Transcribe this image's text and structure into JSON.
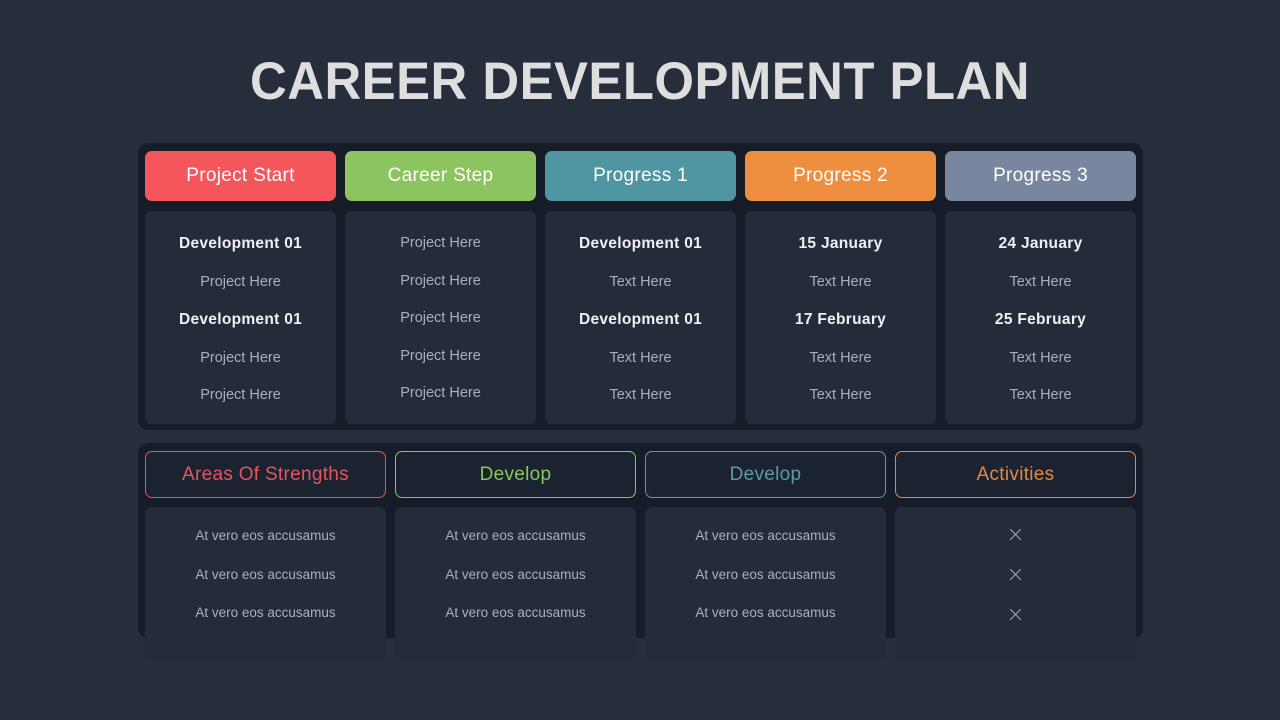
{
  "title": "CAREER DEVELOPMENT PLAN",
  "theme": {
    "page_bg": "#262d3b",
    "panel_bg": "#171d28",
    "card_bg": "#242b39",
    "title_color": "#dedede",
    "body_text": "#a9b0bd",
    "bold_text": "#eef1f5"
  },
  "top_section": {
    "columns": [
      {
        "pill_label": "Project Start",
        "pill_color": "#f4565c",
        "rows": [
          {
            "text": "Development 01",
            "bold": true
          },
          {
            "text": "Project Here",
            "bold": false
          },
          {
            "text": "Development 01",
            "bold": true
          },
          {
            "text": "Project Here",
            "bold": false
          },
          {
            "text": "Project Here",
            "bold": false
          }
        ]
      },
      {
        "pill_label": "Career Step",
        "pill_color": "#8cc45f",
        "rows": [
          {
            "text": "Project Here",
            "bold": false
          },
          {
            "text": "Project Here",
            "bold": false
          },
          {
            "text": "Project Here",
            "bold": false
          },
          {
            "text": "Project Here",
            "bold": false
          },
          {
            "text": "Project Here",
            "bold": false
          }
        ]
      },
      {
        "pill_label": "Progress 1",
        "pill_color": "#4f95a2",
        "rows": [
          {
            "text": "Development 01",
            "bold": true
          },
          {
            "text": "Text Here",
            "bold": false
          },
          {
            "text": "Development 01",
            "bold": true
          },
          {
            "text": "Text Here",
            "bold": false
          },
          {
            "text": "Text Here",
            "bold": false
          }
        ]
      },
      {
        "pill_label": "Progress 2",
        "pill_color": "#ed8f3e",
        "rows": [
          {
            "text": "15 January",
            "bold": true
          },
          {
            "text": "Text Here",
            "bold": false
          },
          {
            "text": "17 February",
            "bold": true
          },
          {
            "text": "Text Here",
            "bold": false
          },
          {
            "text": "Text Here",
            "bold": false
          }
        ]
      },
      {
        "pill_label": "Progress 3",
        "pill_color": "#78879f",
        "rows": [
          {
            "text": "24 January",
            "bold": true
          },
          {
            "text": "Text Here",
            "bold": false
          },
          {
            "text": "25 February",
            "bold": true
          },
          {
            "text": "Text Here",
            "bold": false
          },
          {
            "text": "Text Here",
            "bold": false
          }
        ]
      }
    ]
  },
  "bottom_section": {
    "columns": [
      {
        "button_label": "Areas Of Strengths",
        "accent_color": "#e05760",
        "rows": [
          {
            "text": "At vero eos accusamus",
            "icon": null
          },
          {
            "text": "At vero eos accusamus",
            "icon": null
          },
          {
            "text": "At vero eos accusamus",
            "icon": null
          }
        ]
      },
      {
        "button_label": "Develop",
        "accent_color": "#8cc45f",
        "rows": [
          {
            "text": "At vero eos accusamus",
            "icon": null
          },
          {
            "text": "At vero eos accusamus",
            "icon": null
          },
          {
            "text": "At vero eos accusamus",
            "icon": null
          }
        ]
      },
      {
        "button_label": "Develop",
        "accent_color": "#5c9aa8",
        "rows": [
          {
            "text": "At vero eos accusamus",
            "icon": null
          },
          {
            "text": "At vero eos accusamus",
            "icon": null
          },
          {
            "text": "At vero eos accusamus",
            "icon": null
          }
        ]
      },
      {
        "button_label": "Activities",
        "accent_color": "#e08a45",
        "rows": [
          {
            "text": "",
            "icon": "close-icon"
          },
          {
            "text": "",
            "icon": "close-icon"
          },
          {
            "text": "",
            "icon": "close-icon"
          }
        ]
      }
    ]
  }
}
